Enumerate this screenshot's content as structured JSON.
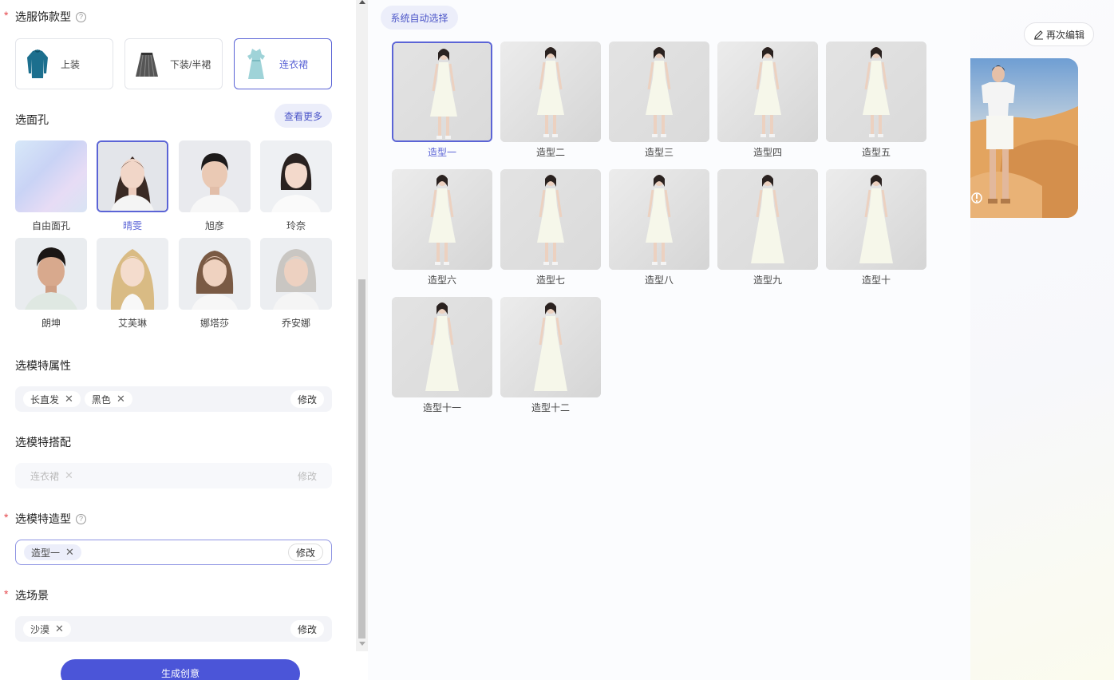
{
  "left": {
    "garment_section": {
      "title": "选服饰款型",
      "required_mark": "*",
      "help": "?"
    },
    "garments": [
      {
        "label": "上装",
        "icon": "top-icon",
        "selected": false
      },
      {
        "label": "下装/半裙",
        "icon": "skirt-icon",
        "selected": false
      },
      {
        "label": "连衣裙",
        "icon": "dress-icon",
        "selected": true
      }
    ],
    "face_section": {
      "title": "选面孔",
      "more": "查看更多"
    },
    "faces": [
      {
        "label": "自由面孔",
        "selected": false
      },
      {
        "label": "晴雯",
        "selected": true
      },
      {
        "label": "旭彦",
        "selected": false
      },
      {
        "label": "玲奈",
        "selected": false
      },
      {
        "label": "朗坤",
        "selected": false
      },
      {
        "label": "艾芙琳",
        "selected": false
      },
      {
        "label": "娜塔莎",
        "selected": false
      },
      {
        "label": "乔安娜",
        "selected": false
      }
    ],
    "attr_section": {
      "title": "选模特属性",
      "tags": [
        "长直发",
        "黑色"
      ],
      "edit": "修改"
    },
    "match_section": {
      "title": "选模特搭配",
      "tags": [
        "连衣裙"
      ],
      "edit": "修改"
    },
    "pose_section": {
      "title": "选模特造型",
      "required_mark": "*",
      "help": "?",
      "tags": [
        "造型一"
      ],
      "edit": "修改"
    },
    "scene_section": {
      "title": "选场景",
      "required_mark": "*",
      "tags": [
        "沙漠"
      ],
      "edit": "修改"
    },
    "generate": "生成创意"
  },
  "middle": {
    "auto_select": "系统自动选择",
    "poses": [
      {
        "label": "造型一",
        "selected": true
      },
      {
        "label": "造型二",
        "selected": false
      },
      {
        "label": "造型三",
        "selected": false
      },
      {
        "label": "造型四",
        "selected": false
      },
      {
        "label": "造型五",
        "selected": false
      },
      {
        "label": "造型六",
        "selected": false
      },
      {
        "label": "造型七",
        "selected": false
      },
      {
        "label": "造型八",
        "selected": false
      },
      {
        "label": "造型九",
        "selected": false
      },
      {
        "label": "造型十",
        "selected": false
      },
      {
        "label": "造型十一",
        "selected": false
      },
      {
        "label": "造型十二",
        "selected": false
      }
    ]
  },
  "right": {
    "reedit": "再次编辑",
    "result_icon": "info-icon"
  },
  "colors": {
    "accent": "#5b64d6",
    "primary_button": "#4b55d8",
    "required": "#e5484d"
  }
}
